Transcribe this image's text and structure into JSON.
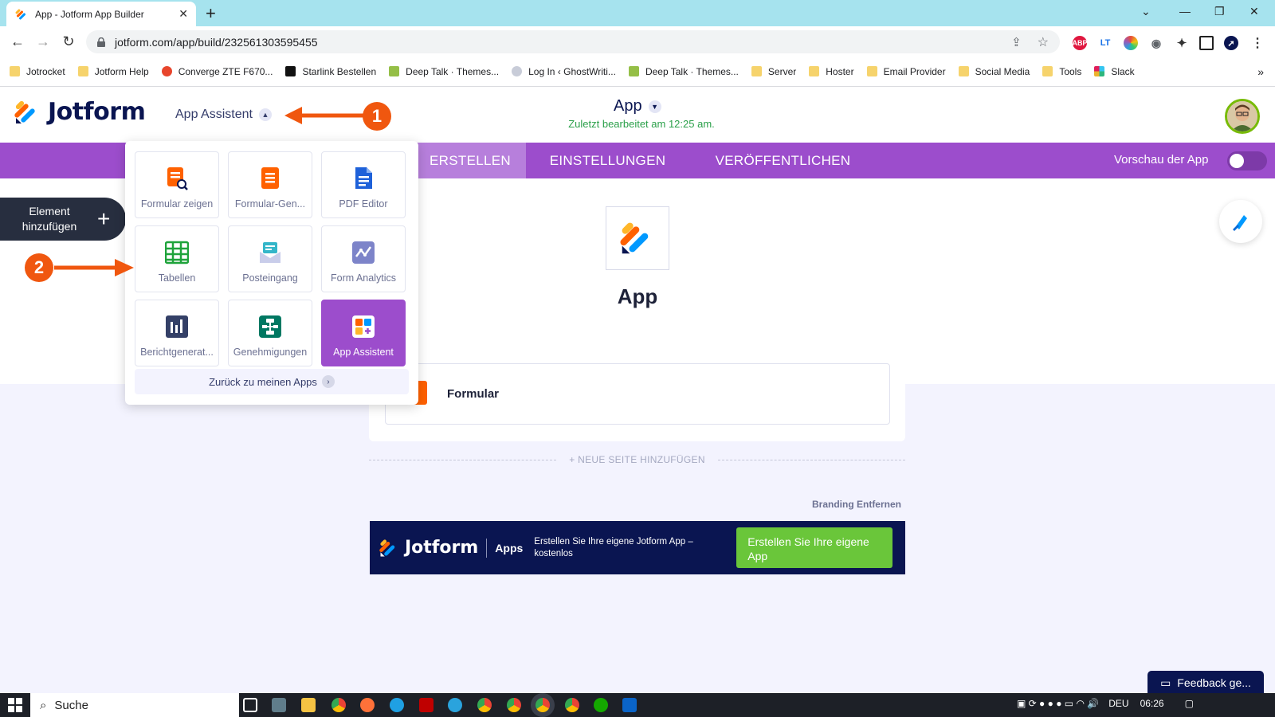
{
  "browser": {
    "tab_title": "App - Jotform App Builder",
    "url": "jotform.com/app/build/232561303595455",
    "bookmarks": [
      "Jotrocket",
      "Jotform Help",
      "Converge ZTE F670...",
      "Starlink Bestellen",
      "Deep Talk · Themes...",
      "Log In ‹ GhostWriti...",
      "Deep Talk · Themes...",
      "Server",
      "Hoster",
      "Email Provider",
      "Social Media",
      "Tools",
      "Slack"
    ],
    "more_bookmarks": "»"
  },
  "header": {
    "logo_text": "Jotform",
    "assistant_menu": "App Assistent",
    "app_name": "App",
    "last_edited": "Zuletzt bearbeitet am 12:25 am."
  },
  "nav": {
    "tab_create": "ERSTELLEN",
    "tab_settings": "EINSTELLUNGEN",
    "tab_publish": "VERÖFFENTLICHEN",
    "preview_label": "Vorschau der App"
  },
  "dropdown": {
    "items": [
      {
        "label": "Formular zeigen",
        "icon": "form-view-icon"
      },
      {
        "label": "Formular-Gen...",
        "icon": "form-builder-icon"
      },
      {
        "label": "PDF Editor",
        "icon": "pdf-editor-icon"
      },
      {
        "label": "Tabellen",
        "icon": "tables-icon"
      },
      {
        "label": "Posteingang",
        "icon": "inbox-icon"
      },
      {
        "label": "Form Analytics",
        "icon": "analytics-icon"
      },
      {
        "label": "Berichtgenerat...",
        "icon": "report-icon"
      },
      {
        "label": "Genehmigungen",
        "icon": "approvals-icon"
      },
      {
        "label": "App Assistent",
        "icon": "app-builder-icon"
      }
    ],
    "back_label": "Zurück zu meinen Apps"
  },
  "builder": {
    "add_element": "Element hinzufügen",
    "app_title": "App",
    "form_item": "Formular",
    "new_page": "+ NEUE SEITE HINZUFÜGEN",
    "branding": "Branding Entfernen",
    "banner_logo": "Jotform",
    "banner_apps": "Apps",
    "banner_text": "Erstellen Sie Ihre eigene Jotform App – kostenlos",
    "banner_button": "Erstellen Sie Ihre eigene App",
    "feedback": "Feedback ge..."
  },
  "annotations": {
    "step1": "1",
    "step2": "2"
  },
  "taskbar": {
    "search": "Suche",
    "lang": "DEU",
    "time": "06:26"
  },
  "colors": {
    "purple": "#9c4dcc",
    "navy": "#0a1551",
    "orange": "#f0570f",
    "green": "#6ac63a"
  }
}
